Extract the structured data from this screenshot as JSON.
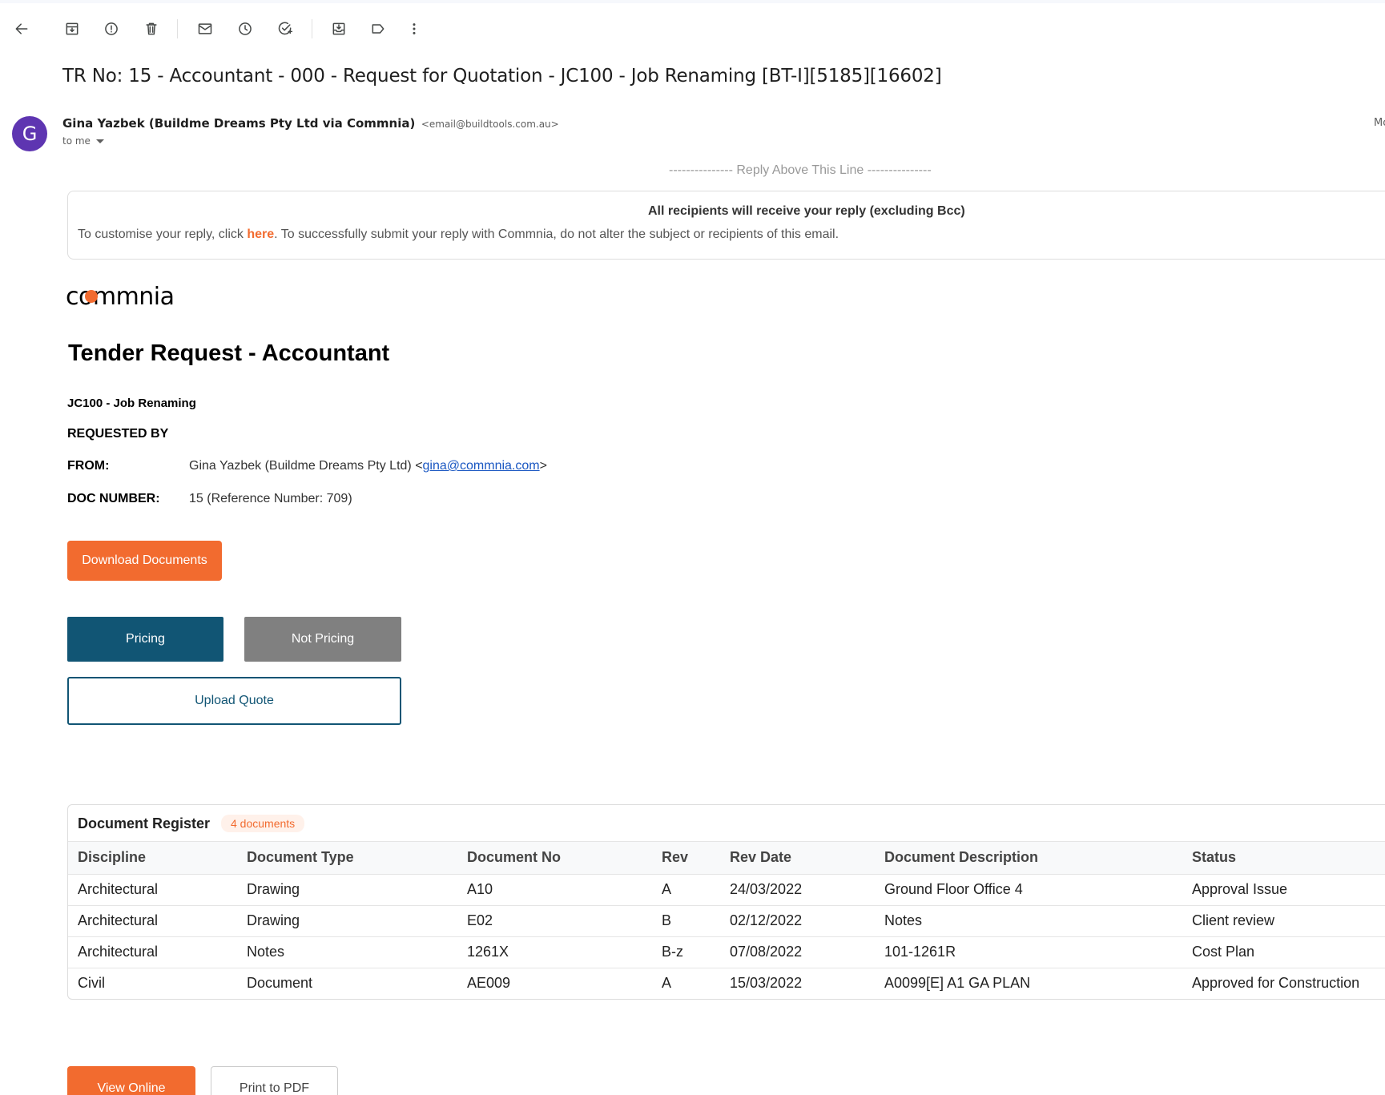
{
  "toolbar": {
    "icons": [
      "back-icon",
      "archive-icon",
      "report-spam-icon",
      "delete-icon",
      "mark-unread-icon",
      "snooze-icon",
      "add-task-icon",
      "move-to-icon",
      "label-icon",
      "more-icon"
    ]
  },
  "email": {
    "subject": "TR No: 15 - Accountant - 000 - Request for Quotation - JC100 - Job Renaming [BT-I][5185][16602]",
    "avatar_letter": "G",
    "avatar_color": "#5e35b1",
    "sender_name": "Gina Yazbek (Buildme Dreams Pty Ltd via Commnia)",
    "sender_email": "<email@buildtools.com.au>",
    "recipient": "to me",
    "date_fragment": "Mo"
  },
  "body": {
    "reply_line": "--------------- Reply Above This Line ---------------",
    "notice_title": "All recipients will receive your reply (excluding Bcc)",
    "notice_pre": "To customise your reply, click ",
    "notice_link": "here",
    "notice_post": ". To successfully submit your reply with Commnia, do not alter the subject or recipients of this email.",
    "logo_text": "commnia",
    "title": "Tender Request - Accountant",
    "job": "JC100 - Job Renaming",
    "requested_by": "REQUESTED BY",
    "from_label": "FROM:",
    "from_name": "Gina Yazbek  (Buildme Dreams Pty Ltd)  <",
    "from_email": "gina@commnia.com",
    "from_close": ">",
    "doc_label": "DOC NUMBER:",
    "doc_value": "15 (Reference Number: 709)",
    "download_label": "Download Documents",
    "pricing_label": "Pricing",
    "not_pricing_label": "Not Pricing",
    "upload_label": "Upload Quote",
    "view_online_label": "View Online",
    "print_label": "Print to PDF"
  },
  "register": {
    "title": "Document Register",
    "badge": "4 documents",
    "columns": [
      "Discipline",
      "Document Type",
      "Document No",
      "Rev",
      "Rev Date",
      "Document Description",
      "Status"
    ],
    "rows": [
      [
        "Architectural",
        "Drawing",
        "A10",
        "A",
        "24/03/2022",
        "Ground Floor Office 4",
        "Approval Issue"
      ],
      [
        "Architectural",
        "Drawing",
        "E02",
        "B",
        "02/12/2022",
        "Notes",
        "Client review"
      ],
      [
        "Architectural",
        "Notes",
        "1261X",
        "B-z",
        "07/08/2022",
        "101-1261R",
        "Cost Plan"
      ],
      [
        "Civil",
        "Document",
        "AE009",
        "A",
        "15/03/2022",
        "A0099[E] A1 GA PLAN",
        "Approved for Construction"
      ]
    ]
  },
  "colors": {
    "accent_orange": "#f26b2f",
    "primary_blue": "#115574",
    "grey_button": "#808080"
  }
}
